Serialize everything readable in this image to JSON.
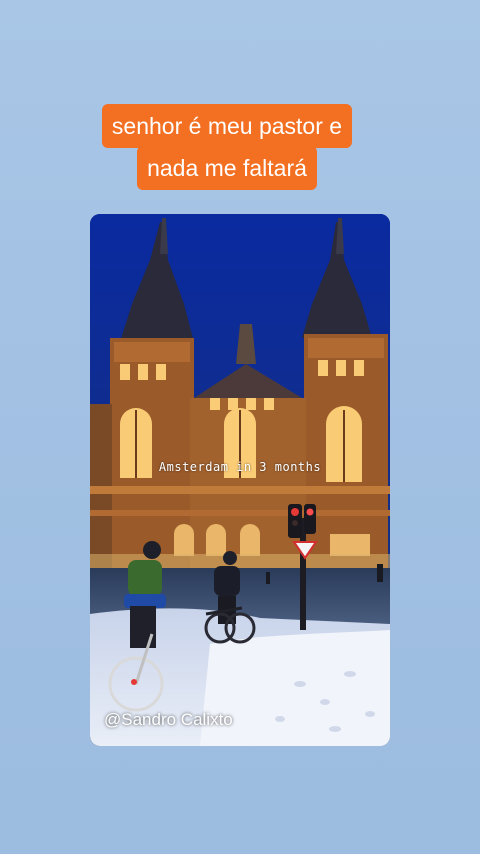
{
  "caption": {
    "line1": "senhor é meu pastor e",
    "line2": "nada me faltará"
  },
  "photo": {
    "overlay_text": "Amsterdam in 3 months",
    "watermark": "@Sandro Calixto"
  },
  "colors": {
    "background": "#a6c4e4",
    "caption_highlight": "#f36f21",
    "night_sky": "#0d2a8a",
    "facade": "#9a5a2a",
    "window_light": "#ffd27a",
    "snow": "#e9eef7"
  }
}
